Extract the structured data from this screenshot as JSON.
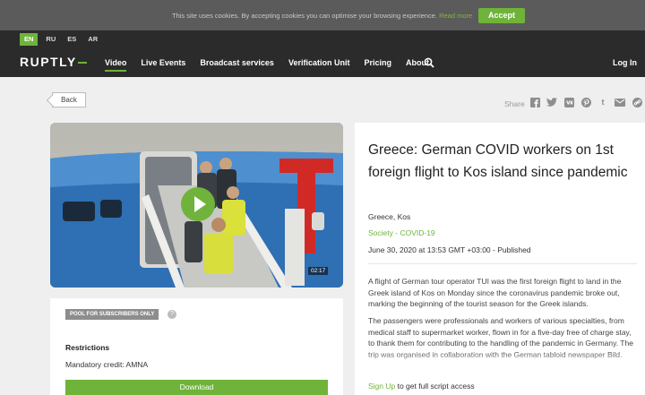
{
  "cookie": {
    "text": "This site uses cookies. By accepting cookies you can optimise your browsing experience.",
    "link": "Read more",
    "accept": "Accept"
  },
  "languages": [
    "EN",
    "RU",
    "ES",
    "AR"
  ],
  "logo": "RUPTLY",
  "menu": [
    "Video",
    "Live Events",
    "Broadcast services",
    "Verification Unit",
    "Pricing",
    "About"
  ],
  "login": "Log In",
  "back": "Back",
  "share": {
    "label": "Share",
    "icons": [
      "facebook-icon",
      "twitter-icon",
      "vk-icon",
      "pinterest-icon",
      "tumblr-icon",
      "mail-icon",
      "link-icon"
    ]
  },
  "video": {
    "duration": "02:17"
  },
  "info": {
    "pool_badge": "POOL FOR SUBSCRIBERS ONLY",
    "help": "?",
    "restrictions_title": "Restrictions",
    "restrictions_text": "Mandatory credit: AMNA",
    "download": "Download"
  },
  "article": {
    "title": "Greece: German COVID workers on 1st foreign flight to Kos island since pandemic",
    "location": "Greece, Kos",
    "tag1": "Society",
    "tag_sep": " - ",
    "tag2": "COVID-19",
    "date": "June 30, 2020 at 13:53 GMT +03:00 - Published",
    "p1": "A flight of German tour operator TUI was the first foreign flight to land in the Greek island of Kos on Monday since the coronavirus pandemic broke out, marking the beginning of the tourist season for the Greek islands.",
    "p2": "The passengers were professionals and workers of various specialties, from medical staff to supermarket worker, flown in for a five-day free of charge stay, to thank them for contributing to the handling of the pandemic in Germany. The trip was organised in collaboration with the German tabloid newspaper Bild.",
    "signup_link": "Sign Up",
    "signup_text": " to get full script access"
  },
  "colors": {
    "accent": "#6fb33a",
    "nav": "#2b2b2b",
    "cookie_bar": "#5b5b5b"
  }
}
